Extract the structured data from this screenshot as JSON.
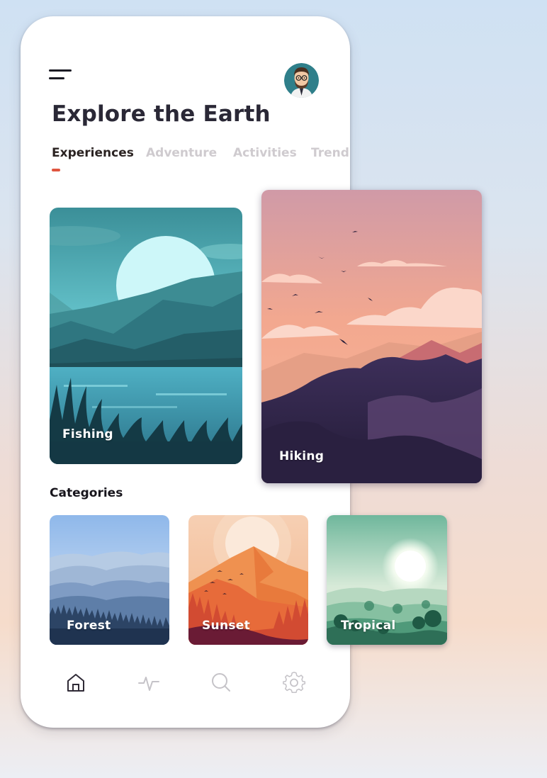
{
  "header": {
    "title": "Explore the Earth"
  },
  "tabs": [
    {
      "label": "Experiences",
      "active": true
    },
    {
      "label": "Adventure",
      "active": false
    },
    {
      "label": "Activities",
      "active": false
    },
    {
      "label": "Trending",
      "active": false
    }
  ],
  "experiences": [
    {
      "label": "Fishing"
    },
    {
      "label": "Hiking"
    }
  ],
  "categories": {
    "title": "Categories",
    "items": [
      {
        "label": "Forest"
      },
      {
        "label": "Sunset"
      },
      {
        "label": "Tropical"
      }
    ]
  },
  "bottom_nav": {
    "items": [
      {
        "icon": "home-icon",
        "active": true
      },
      {
        "icon": "activity-icon",
        "active": false
      },
      {
        "icon": "search-icon",
        "active": false
      },
      {
        "icon": "settings-icon",
        "active": false
      }
    ]
  },
  "colors": {
    "accent": "#e0553f",
    "title": "#2a2836",
    "tab_inactive": "#cfcbcf"
  }
}
